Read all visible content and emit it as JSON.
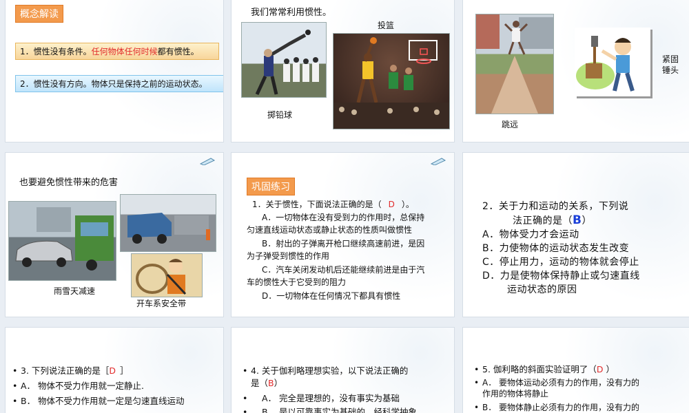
{
  "s1": {
    "tag": "概念解读",
    "line1_a": "1．惯性没有条件。",
    "line1_red": "任何物体任何时候",
    "line1_b": "都有惯性。",
    "line2": "2．惯性没有方向。物体只是保持之前的运动状态。"
  },
  "s2": {
    "title": "我们常常利用惯性。",
    "caption_left": "掷铅球",
    "caption_right": "投篮"
  },
  "s3": {
    "caption_left": "跳远",
    "caption_right_1": "紧固",
    "caption_right_2": "锤头"
  },
  "s4": {
    "title": "也要避免惯性带来的危害",
    "caption_left": "雨雪天减速",
    "caption_right": "开车系安全带"
  },
  "s5": {
    "tag": "巩固练习",
    "q_a": "1．关于惯性，下面说法正确的是（",
    "q_ans": "D",
    "q_b": "）。",
    "optA_1": "A．一切物体在没有受到力的作用时，总保持",
    "optA_2": "匀速直线运动状态或静止状态的性质叫做惯性",
    "optB_1": "B．射出的子弹离开枪口继续高速前进，是因",
    "optB_2": "为子弹受到惯性的作用",
    "optC_1": "C．汽车关闭发动机后还能继续前进是由于汽",
    "optC_2": "车的惯性大于它受到的阻力",
    "optD": "D．一切物体在任何情况下都具有惯性"
  },
  "s6": {
    "q1": "2．关于力和运动的关系，下列说",
    "q2": "法正确的是（",
    "ans": "B",
    "q3": "）",
    "A": "A．物体受力才会运动",
    "B": "B．力使物体的运动状态发生改变",
    "C": "C．停止用力，运动的物体就会停止",
    "D1": "D．力是使物体保持静止或匀速直线",
    "D2": "运动状态的原因"
  },
  "s7": {
    "q": "3. 下列说法正确的是［",
    "ans": "D",
    "q_end": "］",
    "A": "A． 物体不受力作用就一定静止.",
    "B": "B． 物体不受力作用就一定是匀速直线运动"
  },
  "s8": {
    "q1": "4. 关于伽利略理想实验，以下说法正确的",
    "q2": "是（",
    "ans": "B",
    "q3": "）",
    "A": "A． 完全是理想的，没有事实为基础",
    "B": "B． 是以可靠事实为基础的，经科学抽象"
  },
  "s9": {
    "q": "5. 伽利略的斜面实验证明了（",
    "ans": "D",
    "q_end": "）",
    "A1": "A． 要物体运动必须有力的作用，没有力的",
    "A2": "作用的物体将静止",
    "B": "B． 要物体静止必须有力的作用，没有力的"
  }
}
